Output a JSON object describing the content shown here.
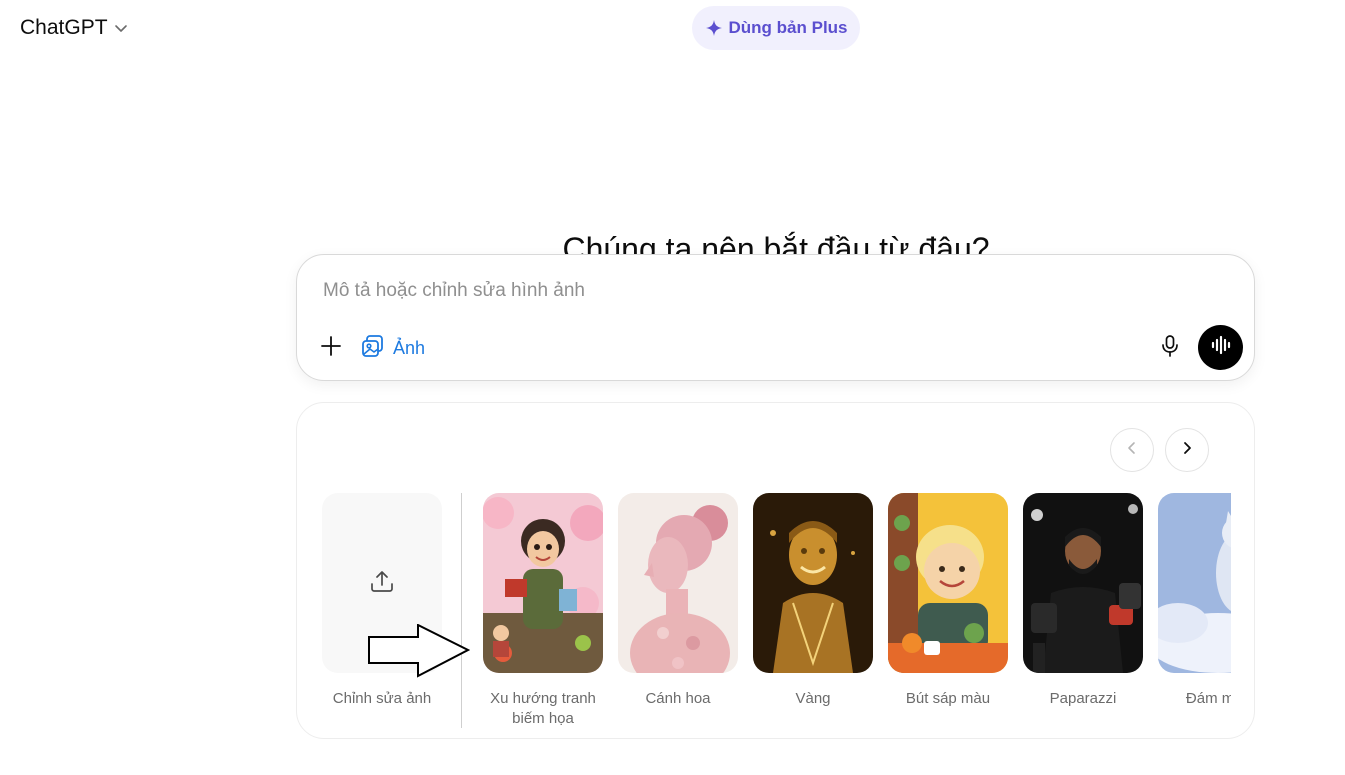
{
  "header": {
    "model_title": "ChatGPT",
    "model_chevron_icon": "chevron-down-icon",
    "upgrade_label": "Dùng bản Plus",
    "upgrade_icon": "sparkle-icon",
    "upgrade_color": "#5b4fcf"
  },
  "main": {
    "headline": "Chúng ta nên bắt đầu từ đâu?"
  },
  "composer": {
    "placeholder": "Mô tả hoặc chỉnh sửa hình ảnh",
    "value": "",
    "plus_icon": "plus-icon",
    "image_chip_label": "Ảnh",
    "image_chip_icon": "image-icon",
    "image_chip_color": "#1d7ae0",
    "mic_icon": "microphone-icon",
    "voice_icon": "voice-waveform-icon"
  },
  "styles": {
    "prev_icon": "chevron-left-icon",
    "next_icon": "chevron-right-icon",
    "upload": {
      "label": "Chỉnh sửa ảnh",
      "icon": "upload-icon"
    },
    "cards": [
      {
        "label": "Xu hướng tranh biếm họa"
      },
      {
        "label": "Cánh hoa"
      },
      {
        "label": "Vàng"
      },
      {
        "label": "Bút sáp màu"
      },
      {
        "label": "Paparazzi"
      },
      {
        "label": "Đám mây"
      }
    ]
  },
  "annotation": {
    "arrow_icon": "arrow-right-outline-icon"
  }
}
